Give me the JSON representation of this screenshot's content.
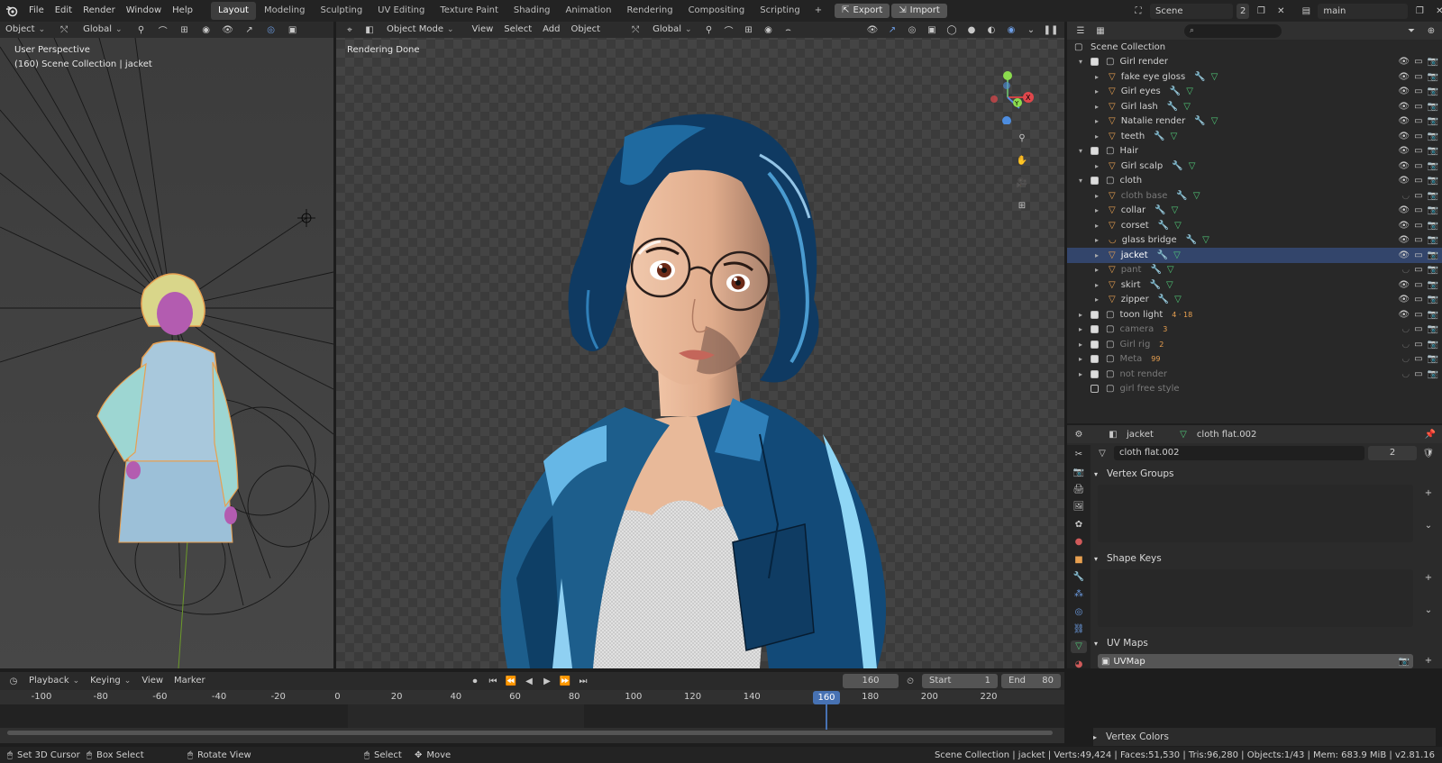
{
  "topbar": {
    "menus": [
      "File",
      "Edit",
      "Render",
      "Window",
      "Help"
    ],
    "workspaces": [
      "Layout",
      "Modeling",
      "Sculpting",
      "UV Editing",
      "Texture Paint",
      "Shading",
      "Animation",
      "Rendering",
      "Compositing",
      "Scripting"
    ],
    "active_workspace": "Layout",
    "add_tab": "+",
    "export_label": "Export",
    "import_label": "Import",
    "scene_name": "Scene",
    "scene_users": "2",
    "view_layer": "main"
  },
  "left_viewport": {
    "mode": "Object",
    "orientation": "Global",
    "view_name": "User Perspective",
    "collection_info": "(160) Scene Collection | jacket"
  },
  "main_viewport": {
    "mode": "Object Mode",
    "menus": [
      "View",
      "Select",
      "Add",
      "Object"
    ],
    "orientation": "Global",
    "status": "Rendering Done"
  },
  "outliner": {
    "search_placeholder": "",
    "root": "Scene Collection",
    "rows": [
      {
        "name": "Girl render",
        "level": 0,
        "type": "collection",
        "checked": true,
        "expanded": true,
        "dim": false,
        "sel": false
      },
      {
        "name": "fake eye gloss",
        "level": 1,
        "type": "mesh",
        "dim": false,
        "sel": false
      },
      {
        "name": "Girl eyes",
        "level": 1,
        "type": "mesh",
        "dim": false,
        "sel": false
      },
      {
        "name": "Girl lash",
        "level": 1,
        "type": "mesh",
        "dim": false,
        "sel": false
      },
      {
        "name": "Natalie render",
        "level": 1,
        "type": "mesh",
        "dim": false,
        "sel": false
      },
      {
        "name": "teeth",
        "level": 1,
        "type": "mesh",
        "dim": false,
        "sel": false
      },
      {
        "name": "Hair",
        "level": 0,
        "type": "collection",
        "checked": true,
        "expanded": true,
        "dim": false,
        "sel": false
      },
      {
        "name": "Girl scalp",
        "level": 1,
        "type": "mesh",
        "dim": false,
        "sel": false
      },
      {
        "name": "cloth",
        "level": 0,
        "type": "collection",
        "checked": true,
        "expanded": true,
        "dim": false,
        "sel": false
      },
      {
        "name": "cloth base",
        "level": 1,
        "type": "mesh",
        "dim": true,
        "sel": false
      },
      {
        "name": "collar",
        "level": 1,
        "type": "mesh",
        "dim": false,
        "sel": false
      },
      {
        "name": "corset",
        "level": 1,
        "type": "mesh",
        "dim": false,
        "sel": false
      },
      {
        "name": "glass bridge",
        "level": 1,
        "type": "curve",
        "dim": false,
        "sel": false
      },
      {
        "name": "jacket",
        "level": 1,
        "type": "mesh",
        "dim": false,
        "sel": true
      },
      {
        "name": "pant",
        "level": 1,
        "type": "mesh",
        "dim": true,
        "sel": false
      },
      {
        "name": "skirt",
        "level": 1,
        "type": "mesh",
        "dim": false,
        "sel": false
      },
      {
        "name": "zipper",
        "level": 1,
        "type": "mesh",
        "dim": false,
        "sel": false
      },
      {
        "name": "toon light",
        "level": 0,
        "type": "collection",
        "checked": true,
        "expanded": false,
        "dim": false,
        "sel": false,
        "badge": "4 · 18"
      },
      {
        "name": "camera",
        "level": 0,
        "type": "collection",
        "checked": true,
        "expanded": false,
        "dim": true,
        "sel": false,
        "badge": "3"
      },
      {
        "name": "Girl rig",
        "level": 0,
        "type": "collection",
        "checked": true,
        "expanded": false,
        "dim": true,
        "sel": false,
        "badge": "2"
      },
      {
        "name": "Meta",
        "level": 0,
        "type": "collection",
        "checked": true,
        "expanded": false,
        "dim": true,
        "sel": false,
        "badge": "99"
      },
      {
        "name": "not render",
        "level": 0,
        "type": "collection",
        "checked": true,
        "expanded": false,
        "dim": true,
        "sel": false
      },
      {
        "name": "girl free style",
        "level": 0,
        "type": "collection",
        "checked": false,
        "expanded": false,
        "dim": true,
        "sel": false
      }
    ]
  },
  "properties": {
    "object_name": "jacket",
    "mesh_name": "cloth flat.002",
    "mesh_users": "2",
    "sections": {
      "vertex_groups": "Vertex Groups",
      "shape_keys": "Shape Keys",
      "uv_maps": "UV Maps",
      "vertex_colors": "Vertex Colors"
    },
    "uv_map_item": "UVMap"
  },
  "timeline": {
    "menus": [
      "Playback",
      "Keying",
      "View",
      "Marker"
    ],
    "current_frame": "160",
    "start_label": "Start",
    "start_value": "1",
    "end_label": "End",
    "end_value": "80",
    "ticks": [
      "-100",
      "-80",
      "-60",
      "-40",
      "-20",
      "0",
      "20",
      "40",
      "60",
      "80",
      "100",
      "120",
      "140",
      "160",
      "180",
      "200",
      "220"
    ],
    "playhead_label": "160"
  },
  "statusbar": {
    "set_cursor": "Set 3D Cursor",
    "box_select": "Box Select",
    "rotate_view": "Rotate View",
    "select": "Select",
    "move": "Move",
    "stats": "Scene Collection | jacket | Verts:49,424 | Faces:51,530 | Tris:96,280 | Objects:1/43 | Mem: 683.9 MiB | v2.81.16"
  },
  "colors": {
    "accent_blue": "#4772b3",
    "selection_row": "#33456b",
    "mesh_icon": "#e8a050",
    "modifier_icon": "#6d9ee6",
    "data_icon": "#50c878"
  }
}
